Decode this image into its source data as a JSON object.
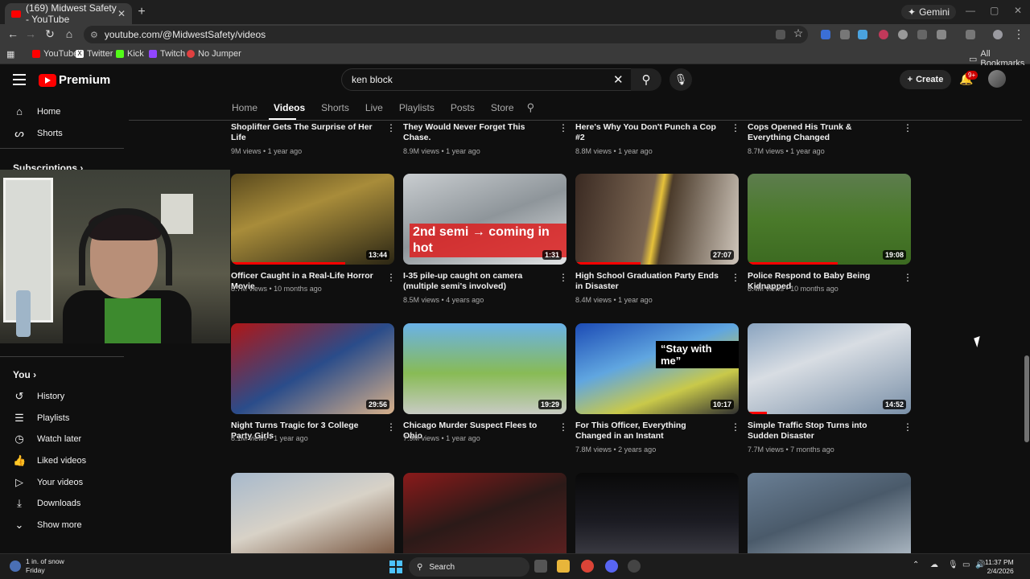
{
  "browser": {
    "tab_title": "(169) Midwest Safety - YouTube",
    "tab_close": "✕",
    "new_tab": "+",
    "gemini": "Gemini",
    "url": "youtube.com/@MidwestSafety/videos",
    "bookmarks": [
      "YouTube",
      "Twitter",
      "Kick",
      "Twitch",
      "No Jumper"
    ],
    "all_bookmarks": "All Bookmarks",
    "win_controls": [
      "—",
      "▢",
      "✕"
    ]
  },
  "yt_header": {
    "logo": "Premium",
    "search_value": "ken block",
    "create": "Create",
    "notif_badge": "9+"
  },
  "channel_tabs": [
    "Home",
    "Videos",
    "Shorts",
    "Live",
    "Playlists",
    "Posts",
    "Store"
  ],
  "active_tab": "Videos",
  "sidebar": {
    "home": "Home",
    "shorts": "Shorts",
    "subscriptions": "Subscriptions",
    "you": "You",
    "items": [
      "History",
      "Playlists",
      "Watch later",
      "Liked videos",
      "Your videos",
      "Downloads",
      "Show more"
    ]
  },
  "videos_row0": [
    {
      "title": "Shoplifter Gets The Surprise of Her Life",
      "meta": "9M views • 1 year ago"
    },
    {
      "title": "They Would Never Forget This Chase.",
      "meta": "8.9M views • 1 year ago"
    },
    {
      "title": "Here's Why You Don't Punch a Cop #2",
      "meta": "8.8M views • 1 year ago"
    },
    {
      "title": "Cops Opened His Trunk & Everything Changed",
      "meta": "8.7M views • 1 year ago"
    }
  ],
  "videos_row1": [
    {
      "title": "Officer Caught in a Real-Life Horror Movie",
      "meta": "8.7M views • 10 months ago",
      "duration": "13:44",
      "progress": 0.7
    },
    {
      "title": "I-35 pile-up caught on camera (multiple semi's involved)",
      "meta": "8.5M views • 4 years ago",
      "duration": "1:31",
      "overlay": "2nd semi → coming in hot"
    },
    {
      "title": "High School Graduation Party Ends in Disaster",
      "meta": "8.4M views • 1 year ago",
      "duration": "27:07",
      "progress": 0.4
    },
    {
      "title": "Police Respond to Baby Being Kidnapped",
      "meta": "8.4M views • 10 months ago",
      "duration": "19:08",
      "progress": 0.55
    }
  ],
  "videos_row2": [
    {
      "title": "Night Turns Tragic for 3 College Party Girls",
      "meta": "8.1M views • 1 year ago",
      "duration": "29:56"
    },
    {
      "title": "Chicago Murder Suspect Flees to Ohio",
      "meta": "7.9M views • 1 year ago",
      "duration": "19:29"
    },
    {
      "title": "For This Officer, Everything Changed in an Instant",
      "meta": "7.8M views • 2 years ago",
      "duration": "10:17",
      "overlay": "“Stay with me”"
    },
    {
      "title": "Simple Traffic Stop Turns into Sudden Disaster",
      "meta": "7.7M views • 7 months ago",
      "duration": "14:52",
      "progress": 0.12
    }
  ],
  "taskbar": {
    "weather_temp": "1 in. of snow",
    "weather_day": "Friday",
    "search": "Search",
    "time": "11:37 PM",
    "date": "2/4/2026"
  },
  "colors": {
    "accent": "#ff0000",
    "bg": "#0f0f0f"
  }
}
